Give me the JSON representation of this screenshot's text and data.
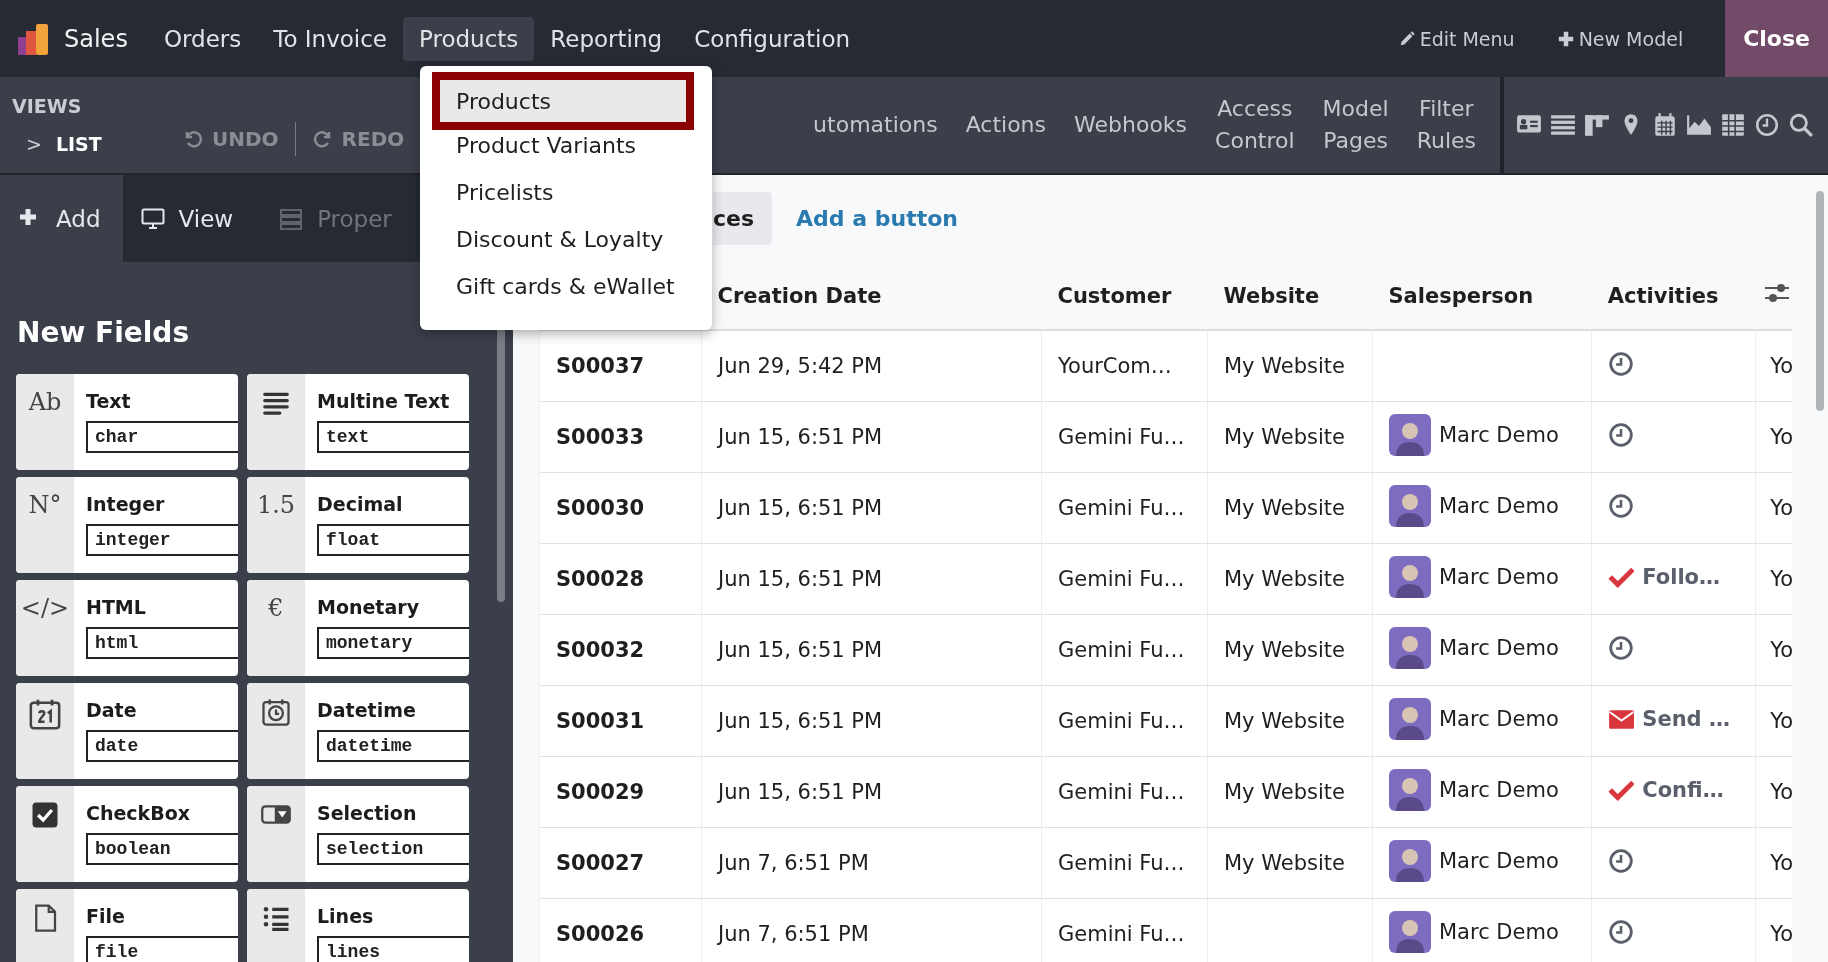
{
  "app": {
    "name": "Sales"
  },
  "top_menu": [
    {
      "label": "Orders",
      "selected": false
    },
    {
      "label": "To Invoice",
      "selected": false
    },
    {
      "label": "Products",
      "selected": true
    },
    {
      "label": "Reporting",
      "selected": false
    },
    {
      "label": "Configuration",
      "selected": false
    }
  ],
  "top_actions": [
    {
      "kind": "edit",
      "label": "Edit Menu"
    },
    {
      "kind": "new",
      "label": "New Model"
    }
  ],
  "close_button": "Close",
  "dropdown": [
    {
      "label": "Products",
      "selected": true
    },
    {
      "label": "Product Variants",
      "selected": false
    },
    {
      "label": "Pricelists",
      "selected": false
    },
    {
      "label": "Discount & Loyalty",
      "selected": false
    },
    {
      "label": "Gift cards & eWallet",
      "selected": false
    }
  ],
  "views": {
    "title": "VIEWS",
    "marker": ">",
    "current": "LIST"
  },
  "history": [
    {
      "kind": "undo",
      "label": "UNDO",
      "disabled": true
    },
    {
      "kind": "redo",
      "label": "REDO",
      "disabled": true
    }
  ],
  "studio_menu": [
    {
      "label": "utomations"
    },
    {
      "label": "Actions"
    },
    {
      "label": "Webhooks"
    },
    {
      "label": "Access Control"
    },
    {
      "label": "Model Pages"
    },
    {
      "label": "Filter Rules"
    }
  ],
  "panel_tabs": [
    {
      "kind": "add",
      "label": "Add",
      "selected": true,
      "disabled": false
    },
    {
      "kind": "view",
      "label": "View",
      "selected": false,
      "disabled": false
    },
    {
      "kind": "properties",
      "label": "Proper",
      "selected": false,
      "disabled": true
    }
  ],
  "new_fields": {
    "title": "New Fields",
    "items": [
      {
        "kind": "glyph",
        "glyph": "Ab",
        "label": "Text",
        "type": "char"
      },
      {
        "kind": "lines",
        "label": "Multine Text",
        "type": "text"
      },
      {
        "kind": "glyph",
        "glyph": "N°",
        "label": "Integer",
        "type": "integer"
      },
      {
        "kind": "glyph",
        "glyph": "1.5",
        "label": "Decimal",
        "type": "float"
      },
      {
        "kind": "glyph",
        "glyph": "</>",
        "label": "HTML",
        "type": "html"
      },
      {
        "kind": "glyph",
        "glyph": "€",
        "label": "Monetary",
        "type": "monetary"
      },
      {
        "kind": "date",
        "label": "Date",
        "type": "date"
      },
      {
        "kind": "datetime",
        "label": "Datetime",
        "type": "datetime"
      },
      {
        "kind": "checkbox",
        "label": "CheckBox",
        "type": "boolean"
      },
      {
        "kind": "selection",
        "label": "Selection",
        "type": "selection"
      },
      {
        "kind": "file",
        "label": "File",
        "type": "file"
      },
      {
        "kind": "list",
        "label": "Lines",
        "type": "lines"
      }
    ]
  },
  "list_toolbar": [
    {
      "kind": "button",
      "label": "ces"
    },
    {
      "kind": "link",
      "label": "Add a button"
    }
  ],
  "table": {
    "columns": [
      "Creation Date",
      "Customer",
      "Website",
      "Salesperson",
      "Activities"
    ],
    "rows": [
      {
        "number": "S00037",
        "date": "Jun 29, 5:42 PM",
        "customer": "YourCom…",
        "website": "My Website",
        "activity": {
          "kind": "clock"
        },
        "column_7": "Yo"
      },
      {
        "number": "S00033",
        "date": "Jun 15, 6:51 PM",
        "customer": "Gemini Fu…",
        "website": "My Website",
        "salesperson": "Marc Demo",
        "activity": {
          "kind": "clock"
        },
        "column_7": "Yo"
      },
      {
        "number": "S00030",
        "date": "Jun 15, 6:51 PM",
        "customer": "Gemini Fu…",
        "website": "My Website",
        "salesperson": "Marc Demo",
        "activity": {
          "kind": "clock"
        },
        "column_7": "Yo"
      },
      {
        "number": "S00028",
        "date": "Jun 15, 6:51 PM",
        "customer": "Gemini Fu…",
        "website": "My Website",
        "salesperson": "Marc Demo",
        "activity": {
          "kind": "check",
          "label": "Follo…"
        },
        "column_7": "Yo"
      },
      {
        "number": "S00032",
        "date": "Jun 15, 6:51 PM",
        "customer": "Gemini Fu…",
        "website": "My Website",
        "salesperson": "Marc Demo",
        "activity": {
          "kind": "clock"
        },
        "column_7": "Yo"
      },
      {
        "number": "S00031",
        "date": "Jun 15, 6:51 PM",
        "customer": "Gemini Fu…",
        "website": "My Website",
        "salesperson": "Marc Demo",
        "activity": {
          "kind": "mail",
          "label": "Send …"
        },
        "column_7": "Yo"
      },
      {
        "number": "S00029",
        "date": "Jun 15, 6:51 PM",
        "customer": "Gemini Fu…",
        "website": "My Website",
        "salesperson": "Marc Demo",
        "activity": {
          "kind": "check",
          "label": "Confi…"
        },
        "column_7": "Yo"
      },
      {
        "number": "S00027",
        "date": "Jun 7, 6:51 PM",
        "customer": "Gemini Fu…",
        "website": "My Website",
        "salesperson": "Marc Demo",
        "activity": {
          "kind": "clock"
        },
        "column_7": "Yo"
      },
      {
        "number": "S00026",
        "date": "Jun 7, 6:51 PM",
        "customer": "Gemini Fu…",
        "salesperson": "Marc Demo",
        "activity": {
          "kind": "clock"
        },
        "column_7": "Yo"
      }
    ]
  }
}
